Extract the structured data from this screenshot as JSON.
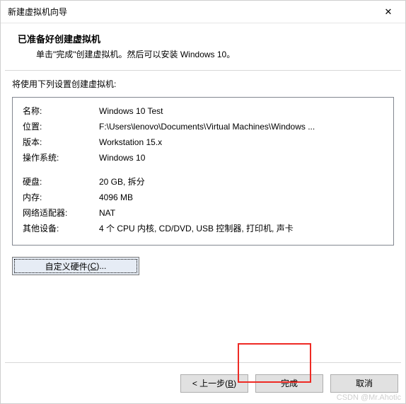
{
  "window": {
    "title": "新建虚拟机向导",
    "close": "✕"
  },
  "header": {
    "title": "已准备好创建虚拟机",
    "subtitle": "单击\"完成\"创建虚拟机。然后可以安装 Windows 10。"
  },
  "intro": "将使用下列设置创建虚拟机:",
  "settings": [
    {
      "label": "名称:",
      "value": "Windows 10 Test"
    },
    {
      "label": "位置:",
      "value": "F:\\Users\\lenovo\\Documents\\Virtual Machines\\Windows ..."
    },
    {
      "label": "版本:",
      "value": "Workstation 15.x"
    },
    {
      "label": "操作系统:",
      "value": "Windows 10"
    }
  ],
  "hardware": [
    {
      "label": "硬盘:",
      "value": "20 GB, 拆分"
    },
    {
      "label": "内存:",
      "value": "4096 MB"
    },
    {
      "label": "网络适配器:",
      "value": "NAT"
    },
    {
      "label": "其他设备:",
      "value": "4 个 CPU 内核, CD/DVD, USB 控制器, 打印机, 声卡"
    }
  ],
  "customize_button": {
    "prefix": "自定义硬件(",
    "hotkey": "C",
    "suffix": ")..."
  },
  "footer": {
    "back_prefix": "< 上一步(",
    "back_hotkey": "B",
    "back_suffix": ")",
    "finish": "完成",
    "cancel": "取消"
  },
  "watermark": "CSDN @Mr.Ahotic"
}
